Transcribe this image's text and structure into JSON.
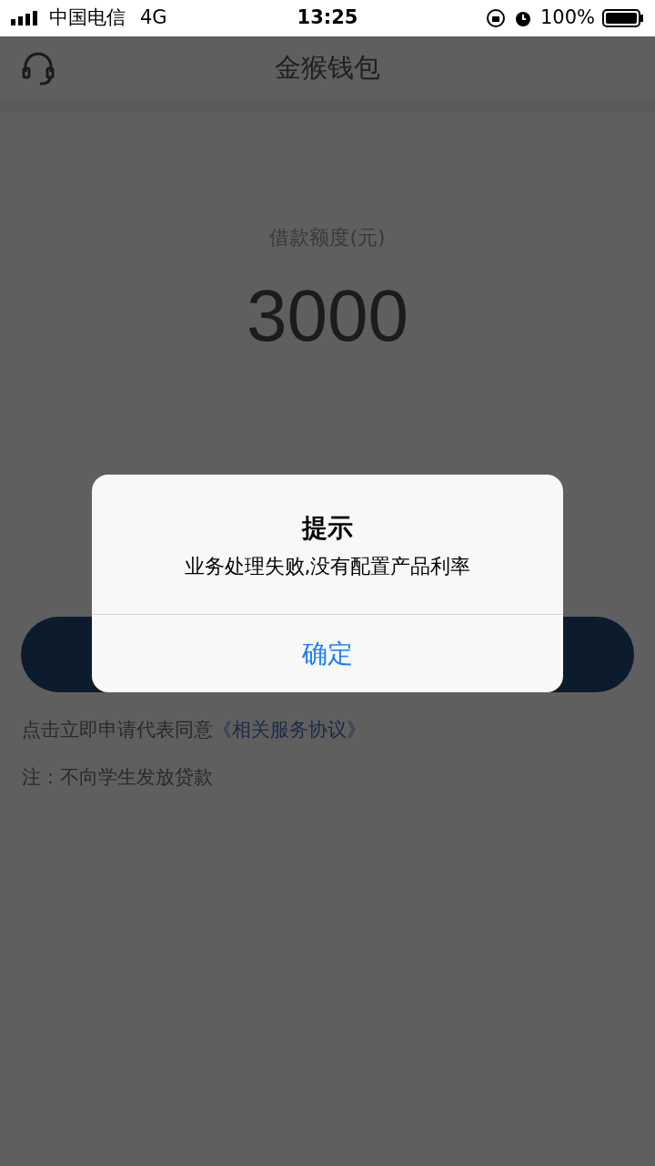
{
  "status_bar": {
    "carrier": "中国电信",
    "network": "4G",
    "time": "13:25",
    "battery": "100%"
  },
  "header": {
    "title": "金猴钱包"
  },
  "loan": {
    "label": "借款额度(元)",
    "amount": "3000"
  },
  "agreement": {
    "text": "点击立即申请代表同意",
    "link": "《相关服务协议》"
  },
  "note": "注：不向学生发放贷款",
  "alert": {
    "title": "提示",
    "message": "业务处理失败,没有配置产品利率",
    "button": "确定"
  }
}
